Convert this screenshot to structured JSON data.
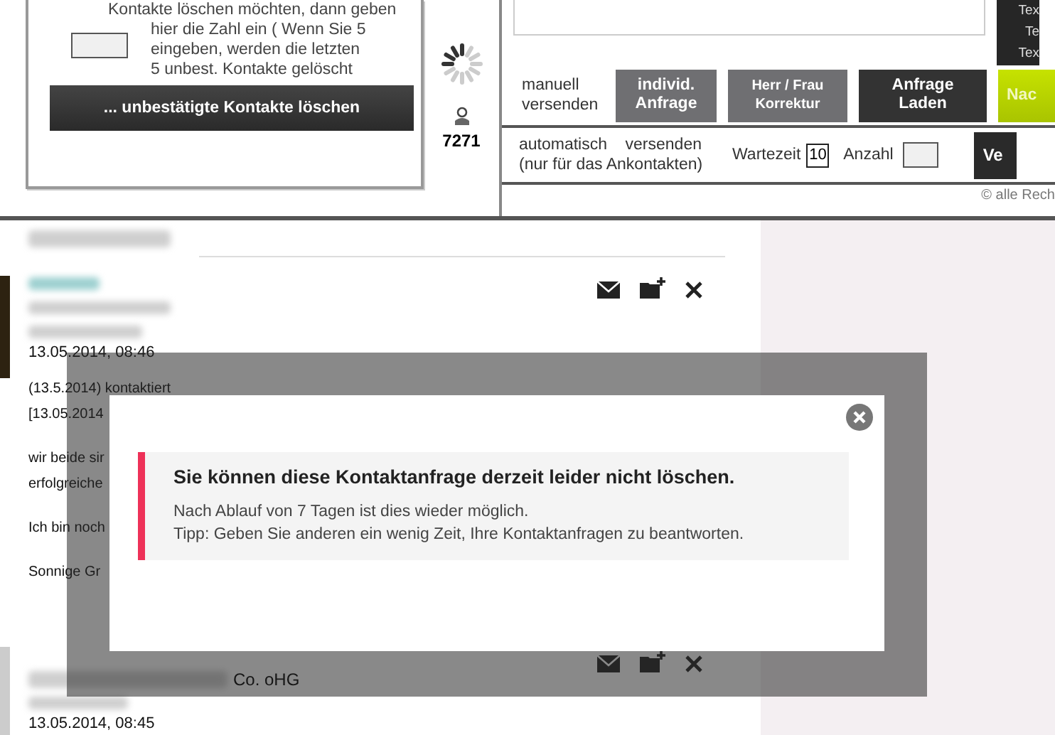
{
  "delete_panel": {
    "instructions": [
      "Kontakte  löschen möchten, dann geben",
      "hier die Zahl ein ( Wenn Sie 5",
      "eingeben,  werden die letzten",
      "5 unbest.  Kontakte  gelöscht"
    ],
    "button": "... unbestätigte Kontakte löschen"
  },
  "status": {
    "count": "7271"
  },
  "template_tabs": [
    "Tex",
    "Te",
    "Tex"
  ],
  "manual_send": {
    "label": [
      "manuell",
      "versenden"
    ],
    "buttons": [
      {
        "kind": "grey",
        "lines": [
          "individ.",
          "Anfrage"
        ]
      },
      {
        "kind": "grey",
        "lines": [
          "Herr / Frau",
          "Korrektur"
        ]
      },
      {
        "kind": "dark",
        "lines": [
          "Anfrage",
          "Laden"
        ]
      },
      {
        "kind": "green",
        "lines": [
          "Nac"
        ]
      }
    ]
  },
  "auto_send": {
    "label": [
      "automatisch    versenden",
      "(nur für das Ankontakten)"
    ],
    "wait_label": "Wartezeit",
    "wait_value": "10",
    "count_label": "Anzahl",
    "button": "Ve"
  },
  "copyright": "© alle Rech",
  "feed": [
    {
      "date": "13.05.2014, 08:46",
      "lines": [
        "(13.5.2014) kontaktiert",
        "[13.05.2014",
        "wir beide sir",
        "erfolgreiche",
        "Ich bin noch",
        "Sonnige Gr"
      ]
    },
    {
      "company_end": "Co. oHG",
      "date": "13.05.2014, 08:45"
    }
  ],
  "dialog": {
    "title": "Sie können diese Kontaktanfrage derzeit leider nicht löschen.",
    "lines": [
      "Nach Ablauf von 7 Tagen ist dies wieder möglich.",
      "Tipp: Geben Sie anderen ein wenig Zeit, Ihre Kontaktanfragen zu beantworten."
    ]
  }
}
